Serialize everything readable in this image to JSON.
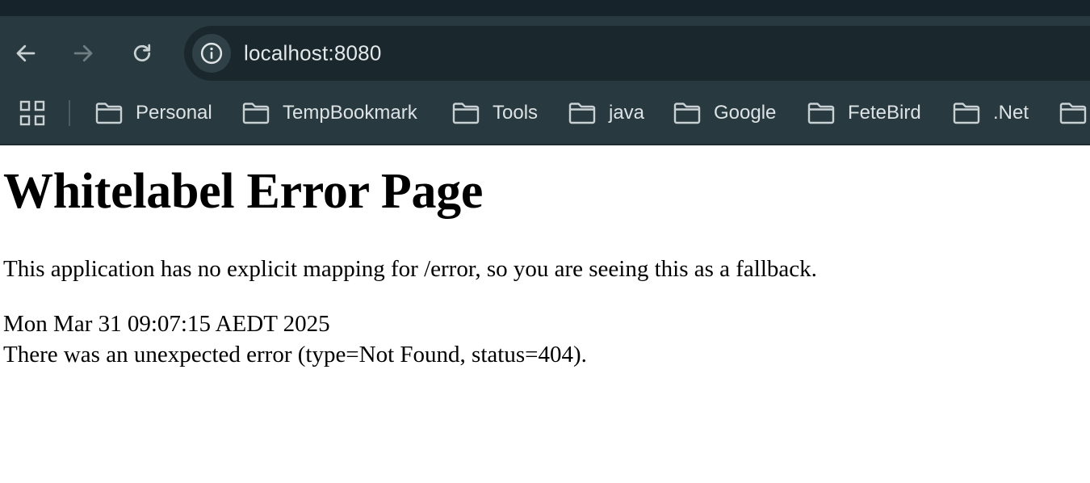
{
  "browser": {
    "url": "localhost:8080",
    "colors": {
      "toolbar": "#28393f",
      "omnibox": "#1a282e",
      "top_strip": "#16232b",
      "icon": "#c9d1d4",
      "icon_disabled": "#6f7e83"
    },
    "nav": {
      "back_icon": "arrow-left-icon",
      "forward_icon": "arrow-right-icon",
      "reload_icon": "reload-icon",
      "site_info_icon": "info-icon"
    },
    "bookmarks": [
      {
        "label": "Personal",
        "icon": "folder-icon"
      },
      {
        "label": "TempBookmark",
        "icon": "folder-icon"
      },
      {
        "label": "Tools",
        "icon": "folder-icon"
      },
      {
        "label": "java",
        "icon": "folder-icon"
      },
      {
        "label": "Google",
        "icon": "folder-icon"
      },
      {
        "label": "FeteBird",
        "icon": "folder-icon"
      },
      {
        "label": ".Net",
        "icon": "folder-icon"
      }
    ]
  },
  "page": {
    "title": "Whitelabel Error Page",
    "message": "This application has no explicit mapping for /error, so you are seeing this as a fallback.",
    "timestamp": "Mon Mar 31 09:07:15 AEDT 2025",
    "error": "There was an unexpected error (type=Not Found, status=404)."
  }
}
